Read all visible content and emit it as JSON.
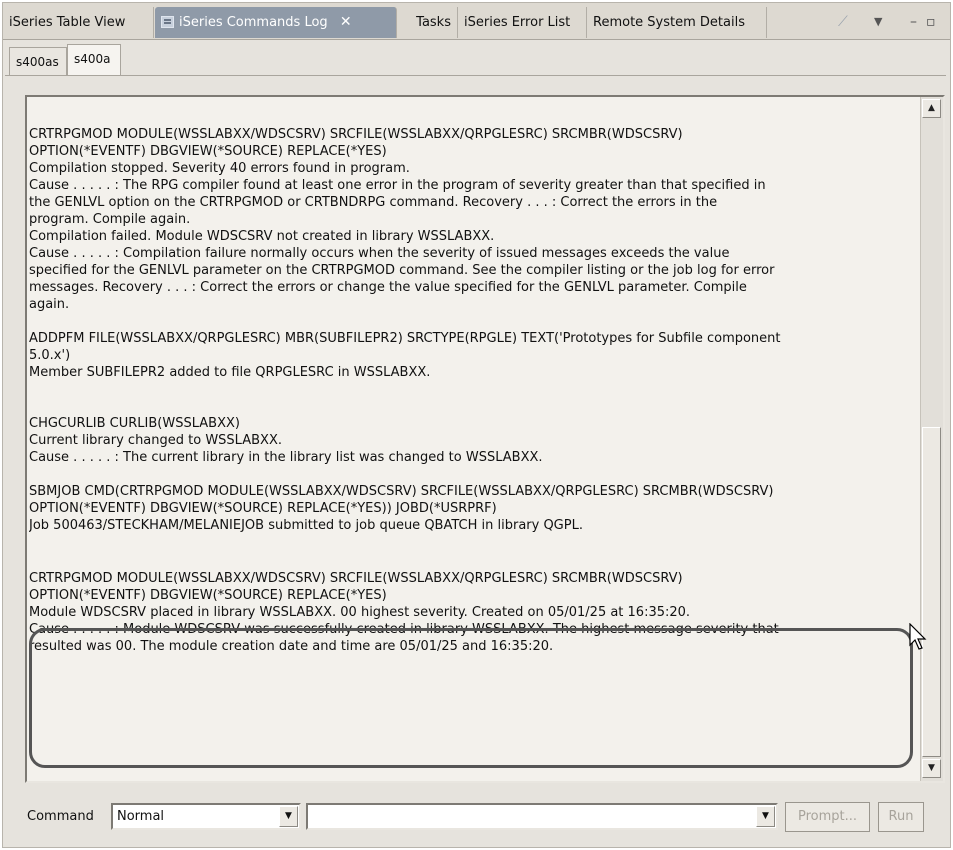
{
  "view_tabs": [
    {
      "label": "iSeries Table View"
    },
    {
      "label": "iSeries Commands Log",
      "active": true,
      "close": "✕"
    },
    {
      "label": "Tasks"
    },
    {
      "label": "iSeries Error List"
    },
    {
      "label": "Remote System Details"
    }
  ],
  "view_tools": {
    "clear": "⟋",
    "menu": "▼",
    "minimize": "–",
    "maximize": "▫"
  },
  "sub_tabs": [
    {
      "label": "s400as"
    },
    {
      "label": "s400a",
      "active": true
    }
  ],
  "log": [
    {
      "lines": [
        "CRTRPGMOD MODULE(WSSLABXX/WDSCSRV) SRCFILE(WSSLABXX/QRPGLESRC) SRCMBR(WDSCSRV)",
        "OPTION(*EVENTF) DBGVIEW(*SOURCE) REPLACE(*YES)",
        "Compilation stopped. Severity 40 errors found in program.",
        "Cause . . . . . :   The RPG compiler found at least one error in the program of severity greater than that specified in",
        "the GENLVL option on the CRTRPGMOD or CRTBNDRPG command. Recovery  . . . :   Correct the errors in the",
        "program. Compile again.",
        "Compilation failed. Module WDSCSRV not created in library WSSLABXX.",
        "Cause . . . . . :   Compilation failure normally occurs when the severity of issued messages exceeds the value",
        "specified for the GENLVL parameter on the CRTRPGMOD command. See the compiler listing or the job log for error",
        "messages. Recovery  . . . :   Correct the errors or change the value specified for the GENLVL parameter. Compile",
        "again."
      ]
    },
    {
      "lines": [
        "ADDPFM FILE(WSSLABXX/QRPGLESRC) MBR(SUBFILEPR2) SRCTYPE(RPGLE) TEXT('Prototypes for Subfile component",
        "5.0.x')",
        "Member SUBFILEPR2 added to file QRPGLESRC in WSSLABXX."
      ]
    },
    {
      "lines": [
        "",
        "CHGCURLIB CURLIB(WSSLABXX)",
        "Current library changed to WSSLABXX.",
        "Cause . . . . . :   The current library in the library list was changed to WSSLABXX."
      ]
    },
    {
      "lines": [
        "SBMJOB CMD(CRTRPGMOD MODULE(WSSLABXX/WDSCSRV) SRCFILE(WSSLABXX/QRPGLESRC) SRCMBR(WDSCSRV)",
        "OPTION(*EVENTF) DBGVIEW(*SOURCE) REPLACE(*YES)) JOBD(*USRPRF)",
        "Job 500463/STECKHAM/MELANIEJOB submitted to job queue QBATCH in library QGPL."
      ]
    },
    {
      "lines": [
        "CRTRPGMOD MODULE(WSSLABXX/WDSCSRV) SRCFILE(WSSLABXX/QRPGLESRC) SRCMBR(WDSCSRV)",
        "OPTION(*EVENTF) DBGVIEW(*SOURCE) REPLACE(*YES)",
        "Module WDSCSRV placed in library WSSLABXX. 00 highest severity. Created on 05/01/25 at 16:35:20.",
        "Cause . . . . . :   Module WDSCSRV was successfully created in library WSSLABXX. The highest message severity that",
        "resulted was 00. The module creation date and time are 05/01/25 and 16:35:20."
      ]
    }
  ],
  "scrollbar": {
    "up": "▲",
    "down": "▼"
  },
  "command_bar": {
    "label": "Command",
    "mode_value": "Normal",
    "command_value": "",
    "dropdown_arrow": "▼",
    "prompt_label": "Prompt...",
    "run_label": "Run"
  }
}
